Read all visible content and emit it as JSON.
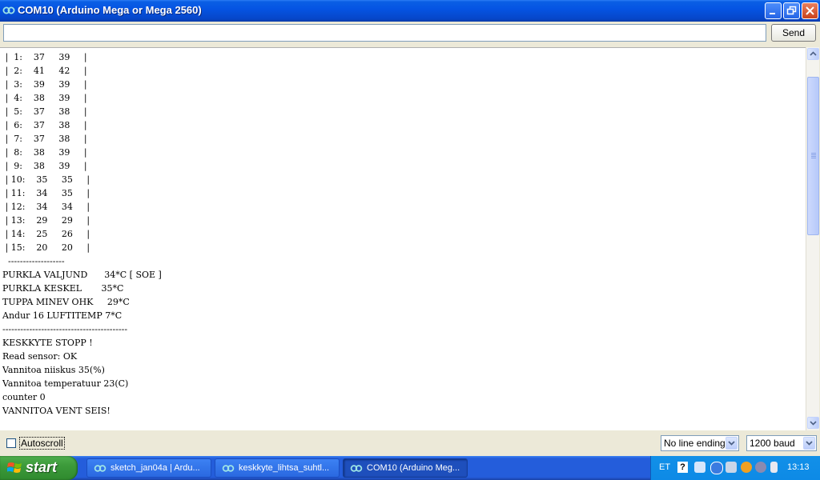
{
  "window": {
    "title": "COM10 (Arduino Mega or Mega 2560)"
  },
  "send_row": {
    "input_value": "",
    "send_label": "Send"
  },
  "output": {
    "lines": [
      " |  1:    37     39     |",
      " |  2:    41     42     |",
      " |  3:    39     39     |",
      " |  4:    38     39     |",
      " |  5:    37     38     |",
      " |  6:    37     38     |",
      " |  7:    37     38     |",
      " |  8:    38     39     |",
      " |  9:    38     39     |",
      " | 10:    35     35     |",
      " | 11:    34     35     |",
      " | 12:    34     34     |",
      " | 13:    29     29     |",
      " | 14:    25     26     |",
      " | 15:    20     20     |",
      "  -------------------",
      "PURKLA VALJUND      34*C [ SOE ]",
      "PURKLA KESKEL       35*C",
      "TUPPA MINEV OHK     29*C",
      "Andur 16 LUFTITEMP 7*C",
      "------------------------------------------",
      "KESKKYTE STOPP !",
      "Read sensor: OK",
      "Vannitoa niiskus 35(%)",
      "Vannitoa temperatuur 23(C)",
      "counter 0",
      "VANNITOA VENT SEIS!"
    ]
  },
  "bottom": {
    "autoscroll_label": "Autoscroll",
    "autoscroll_checked": false,
    "line_ending": "No line ending",
    "baud": "1200 baud"
  },
  "taskbar": {
    "start_label": "start",
    "tasks": [
      {
        "label": "sketch_jan04a | Ardu..."
      },
      {
        "label": "keskkyte_lihtsa_suhtl..."
      },
      {
        "label": "COM10 (Arduino Meg..."
      }
    ],
    "tray": {
      "language": "ET",
      "help_icon": "?",
      "time": "13:13"
    }
  },
  "colors": {
    "titlebar": "#0554e3",
    "taskbar": "#245ddb",
    "start_button": "#3c9a3a",
    "tray": "#0d8ae6",
    "window_bg": "#ECE9D8"
  }
}
